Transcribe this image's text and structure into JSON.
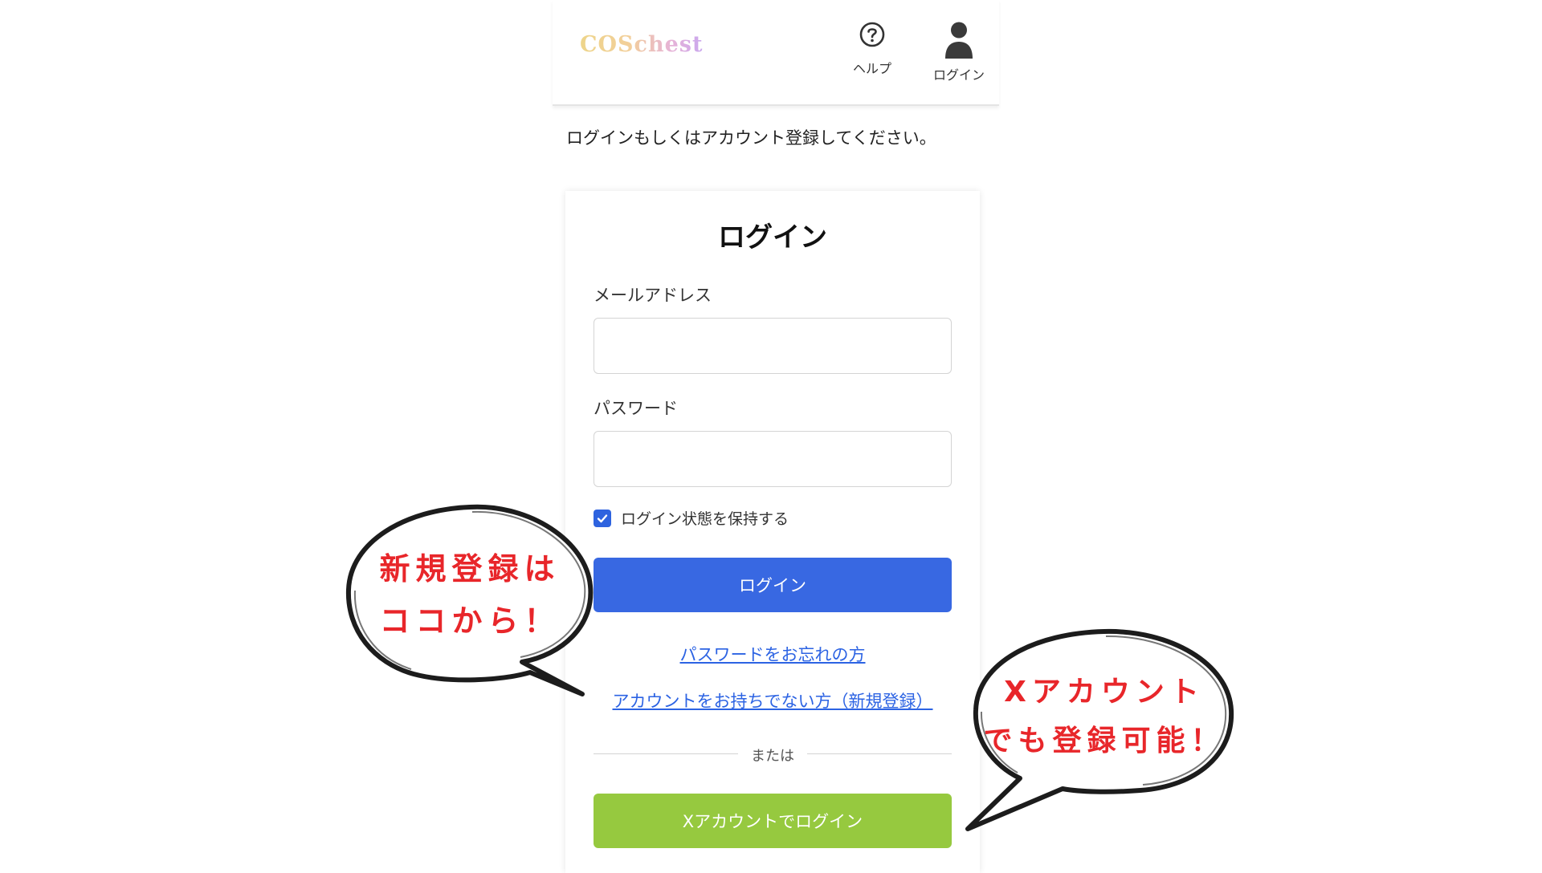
{
  "header": {
    "logo": "COSchest",
    "help_label": "ヘルプ",
    "login_label": "ログイン"
  },
  "intro_text": "ログインもしくはアカウント登録してください。",
  "card": {
    "title": "ログイン",
    "email_label": "メールアドレス",
    "email_value": "",
    "password_label": "パスワード",
    "password_value": "",
    "remember_label": "ログイン状態を保持する",
    "remember_checked": true,
    "login_button": "ログイン",
    "forgot_link": "パスワードをお忘れの方",
    "register_link": "アカウントをお持ちでない方（新規登録）",
    "divider_text": "または",
    "x_login_button": "Xアカウントでログイン"
  },
  "callouts": {
    "left_line1": "新規登録は",
    "left_line2": "ココから！",
    "right_line1": "Xアカウント",
    "right_line2": "でも登録可能！"
  },
  "colors": {
    "primary_button": "#3868e2",
    "x_button": "#96c93f",
    "link": "#2c63e3",
    "callout_text": "#e8262a"
  },
  "icons": {
    "help": "question-circle-icon",
    "user": "user-icon",
    "check": "checkmark-icon"
  }
}
